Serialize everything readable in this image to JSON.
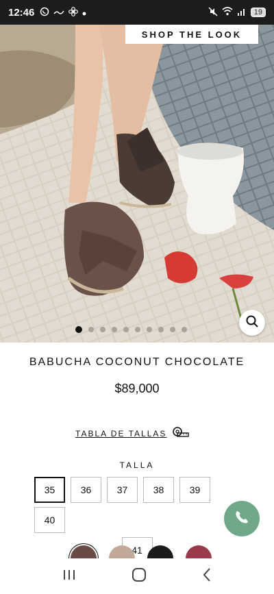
{
  "status": {
    "time": "12:46",
    "left_icons": [
      "whatsapp-icon",
      "wave-icon",
      "fan-icon",
      "dot-icon"
    ],
    "battery": "19"
  },
  "hero": {
    "shop_the_look": "SHOP THE LOOK",
    "carousel_total": 10,
    "carousel_active": 0
  },
  "product": {
    "title": "BABUCHA COCONUT CHOCOLATE",
    "price": "$89,000"
  },
  "size_guide": {
    "label": "TABLA DE TALLAS"
  },
  "talla": {
    "label": "TALLA",
    "sizes": [
      "35",
      "36",
      "37",
      "38",
      "39",
      "40",
      "41"
    ],
    "selected": "35"
  },
  "swatches": {
    "colors": [
      "#6b4a45",
      "#c2a898",
      "#1a1a1a",
      "#9b3a4a"
    ],
    "selected": 0
  },
  "accent": {
    "whatsapp": "#6fa98a"
  }
}
